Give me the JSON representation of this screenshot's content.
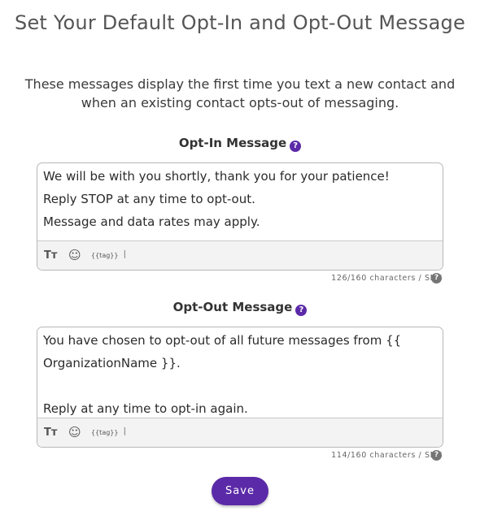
{
  "page": {
    "title": "Set Your Default Opt-In and Opt-Out Message",
    "description": "These messages display the first time you text a new contact and when an existing contact opts-out of messaging."
  },
  "opt_in": {
    "label": "Opt-In Message",
    "help_glyph": "?",
    "lines": [
      "We will be with you shortly, thank you for your patience!",
      "Reply STOP at any time to opt-out.",
      "Message and data rates may apply."
    ],
    "counter": "126/160 characters / SMS"
  },
  "opt_out": {
    "label": "Opt-Out Message",
    "help_glyph": "?",
    "lines": [
      "You have chosen to opt-out of all future messages from {{",
      "OrganizationName }}.",
      "",
      "Reply at any time to opt-in again."
    ],
    "counter": "114/160 characters / SMS"
  },
  "toolbar": {
    "text_format_glyph": "Tт",
    "emoji_glyph": "☺",
    "tag_label": "{{tag}}",
    "attach_glyph": "⦚"
  },
  "actions": {
    "save_label": "Save"
  },
  "colors": {
    "accent": "#5b2aa8",
    "border": "#b8b8b8",
    "toolbar_bg": "#f3f3f3"
  },
  "icons": [
    "text-format-icon",
    "emoji-icon",
    "tag-icon",
    "paperclip-icon",
    "question-icon"
  ]
}
